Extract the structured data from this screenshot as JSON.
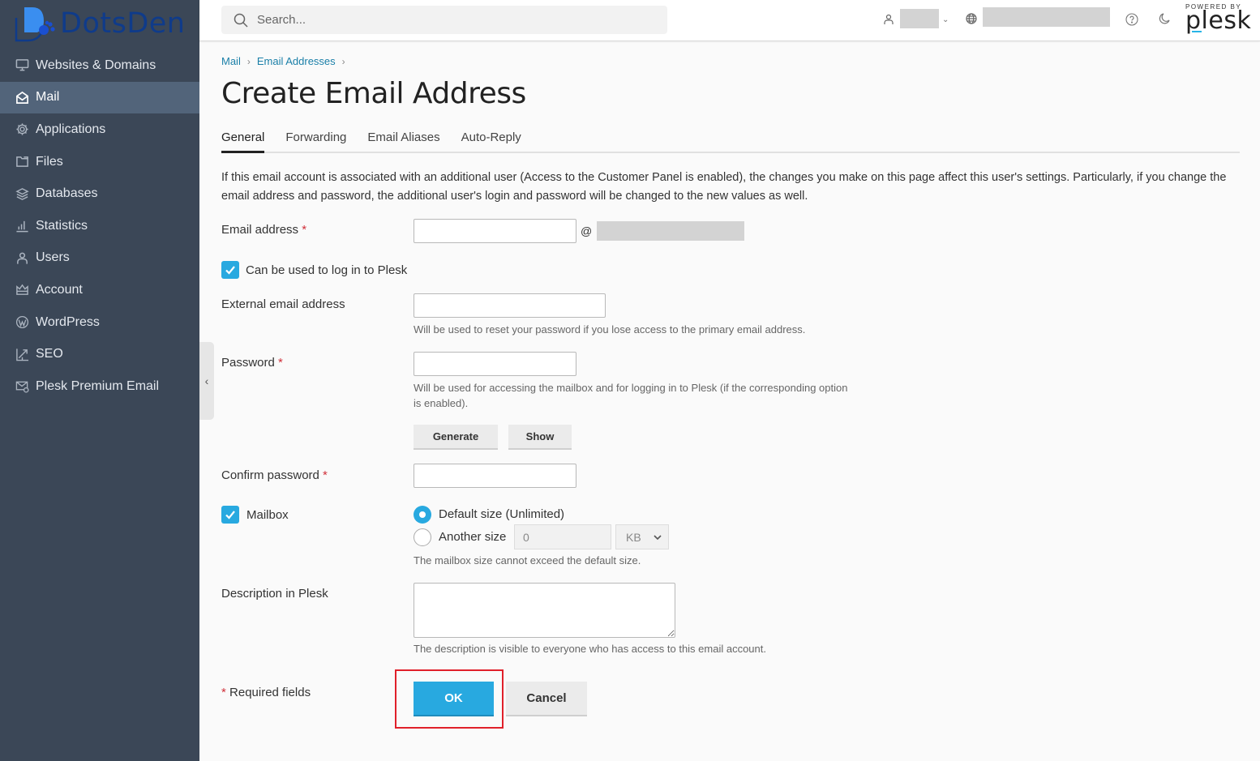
{
  "brand": {
    "name": "DotsDen",
    "logo_colors": {
      "primary": "#2f7fe6",
      "dark": "#0f3b8a"
    }
  },
  "sidebar": {
    "items": [
      {
        "label": "Websites & Domains",
        "icon": "monitor-icon",
        "active": false
      },
      {
        "label": "Mail",
        "icon": "mail-icon",
        "active": true
      },
      {
        "label": "Applications",
        "icon": "gear-icon",
        "active": false
      },
      {
        "label": "Files",
        "icon": "folder-icon",
        "active": false
      },
      {
        "label": "Databases",
        "icon": "layers-icon",
        "active": false
      },
      {
        "label": "Statistics",
        "icon": "bar-chart-icon",
        "active": false
      },
      {
        "label": "Users",
        "icon": "user-icon",
        "active": false
      },
      {
        "label": "Account",
        "icon": "crown-icon",
        "active": false
      },
      {
        "label": "WordPress",
        "icon": "wordpress-icon",
        "active": false
      },
      {
        "label": "SEO",
        "icon": "trend-up-icon",
        "active": false
      },
      {
        "label": "Plesk Premium Email",
        "icon": "premium-mail-icon",
        "active": false
      }
    ],
    "collapse_icon": "chevron-left-icon"
  },
  "header": {
    "search_placeholder": "Search...",
    "powered_by": "POWERED BY",
    "plesk_word": "plesk"
  },
  "breadcrumb": [
    {
      "label": "Mail"
    },
    {
      "label": "Email Addresses"
    }
  ],
  "page_title": "Create Email Address",
  "tabs": [
    {
      "label": "General",
      "active": true
    },
    {
      "label": "Forwarding",
      "active": false
    },
    {
      "label": "Email Aliases",
      "active": false
    },
    {
      "label": "Auto-Reply",
      "active": false
    }
  ],
  "intro_text": "If this email account is associated with an additional user (Access to the Customer Panel is enabled), the changes you make on this page affect this user's settings. Particularly, if you change the email address and password, the additional user's login and password will be changed to the new values as well.",
  "form": {
    "email_address": {
      "label": "Email address",
      "required_mark": "*",
      "value": "",
      "at": "@"
    },
    "login_checkbox": {
      "label": "Can be used to log in to Plesk",
      "checked": true
    },
    "external_email": {
      "label": "External email address",
      "value": "",
      "hint": "Will be used to reset your password if you lose access to the primary email address."
    },
    "password": {
      "label": "Password",
      "required_mark": "*",
      "value": "",
      "hint": "Will be used for accessing the mailbox and for logging in to Plesk (if the corresponding option is enabled).",
      "generate_label": "Generate",
      "show_label": "Show"
    },
    "confirm_password": {
      "label": "Confirm password",
      "required_mark": "*",
      "value": ""
    },
    "mailbox": {
      "label": "Mailbox",
      "checked": true,
      "default_size_label": "Default size (Unlimited)",
      "another_size_label": "Another size",
      "size_value": "0",
      "unit": "KB",
      "selected": "default",
      "hint": "The mailbox size cannot exceed the default size."
    },
    "description": {
      "label": "Description in Plesk",
      "value": "",
      "hint": "The description is visible to everyone who has access to this email account."
    },
    "required_note": {
      "mark": "*",
      "text": "Required fields"
    },
    "ok_label": "OK",
    "cancel_label": "Cancel"
  },
  "colors": {
    "sidebar_bg": "#3b4757",
    "sidebar_active": "#52647a",
    "accent": "#28a9e0",
    "link": "#1a7fa8",
    "required": "#d0303a",
    "highlight": "#e0202a"
  }
}
